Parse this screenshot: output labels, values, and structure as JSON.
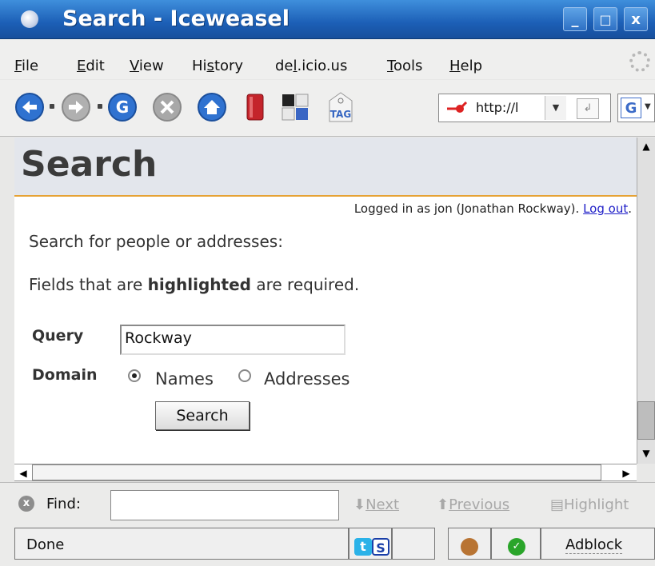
{
  "window": {
    "title": "Search - Iceweasel",
    "controls": {
      "minimize": "_",
      "maximize": "□",
      "close": "x"
    }
  },
  "menubar": {
    "items": [
      {
        "pre": "",
        "ul": "F",
        "post": "ile"
      },
      {
        "pre": "",
        "ul": "E",
        "post": "dit"
      },
      {
        "pre": "",
        "ul": "V",
        "post": "iew"
      },
      {
        "pre": "Hi",
        "ul": "s",
        "post": "tory"
      },
      {
        "pre": "de",
        "ul": "l",
        "post": ".icio.us"
      },
      {
        "pre": "",
        "ul": "T",
        "post": "ools"
      },
      {
        "pre": "",
        "ul": "H",
        "post": "elp"
      }
    ]
  },
  "toolbar": {
    "url": "http://l",
    "tag_label": "TAG",
    "search_engine": "G"
  },
  "page": {
    "title": "Search",
    "login_text": "Logged in as jon (Jonathan Rockway). ",
    "logout_link": "Log out",
    "logout_suffix": ".",
    "intro": "Search for people or addresses:",
    "required_pre": "Fields that are ",
    "required_bold": "highlighted",
    "required_post": " are required.",
    "form": {
      "query_label": "Query",
      "query_value": "Rockway",
      "domain_label": "Domain",
      "options": [
        {
          "label": "Names",
          "checked": true
        },
        {
          "label": "Addresses",
          "checked": false
        }
      ],
      "submit_label": "Search"
    }
  },
  "findbar": {
    "label": "Find:",
    "next": "Next",
    "previous": "Previous",
    "highlight": "Highlight"
  },
  "statusbar": {
    "status": "Done",
    "twitter_icon": "t",
    "s_icon": "S",
    "adblock": "Adblock"
  },
  "colors": {
    "titlebar": "#1c5fb6",
    "header_border": "#e6a235",
    "link": "#2020c8"
  }
}
